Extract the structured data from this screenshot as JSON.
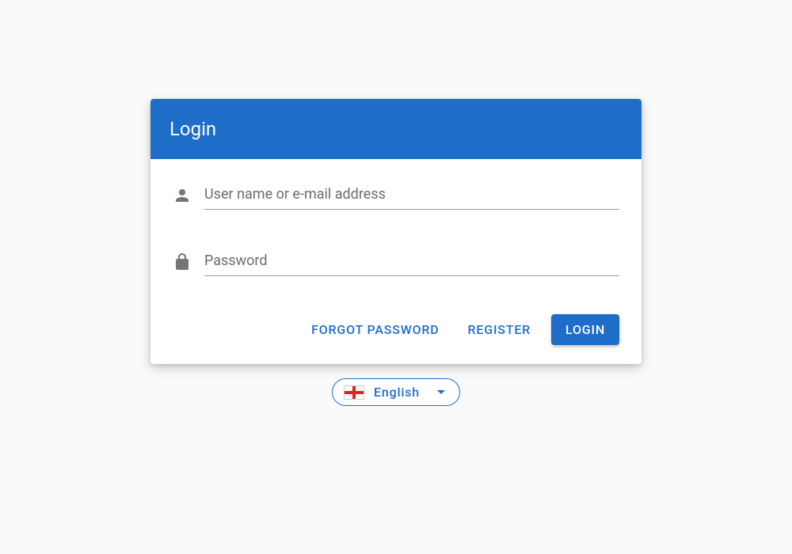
{
  "header": {
    "title": "Login"
  },
  "fields": {
    "username": {
      "placeholder": "User name or e-mail address",
      "value": ""
    },
    "password": {
      "placeholder": "Password",
      "value": ""
    }
  },
  "actions": {
    "forgot": "Forgot Password",
    "register": "Register",
    "login": "Login"
  },
  "language": {
    "label": "English"
  }
}
